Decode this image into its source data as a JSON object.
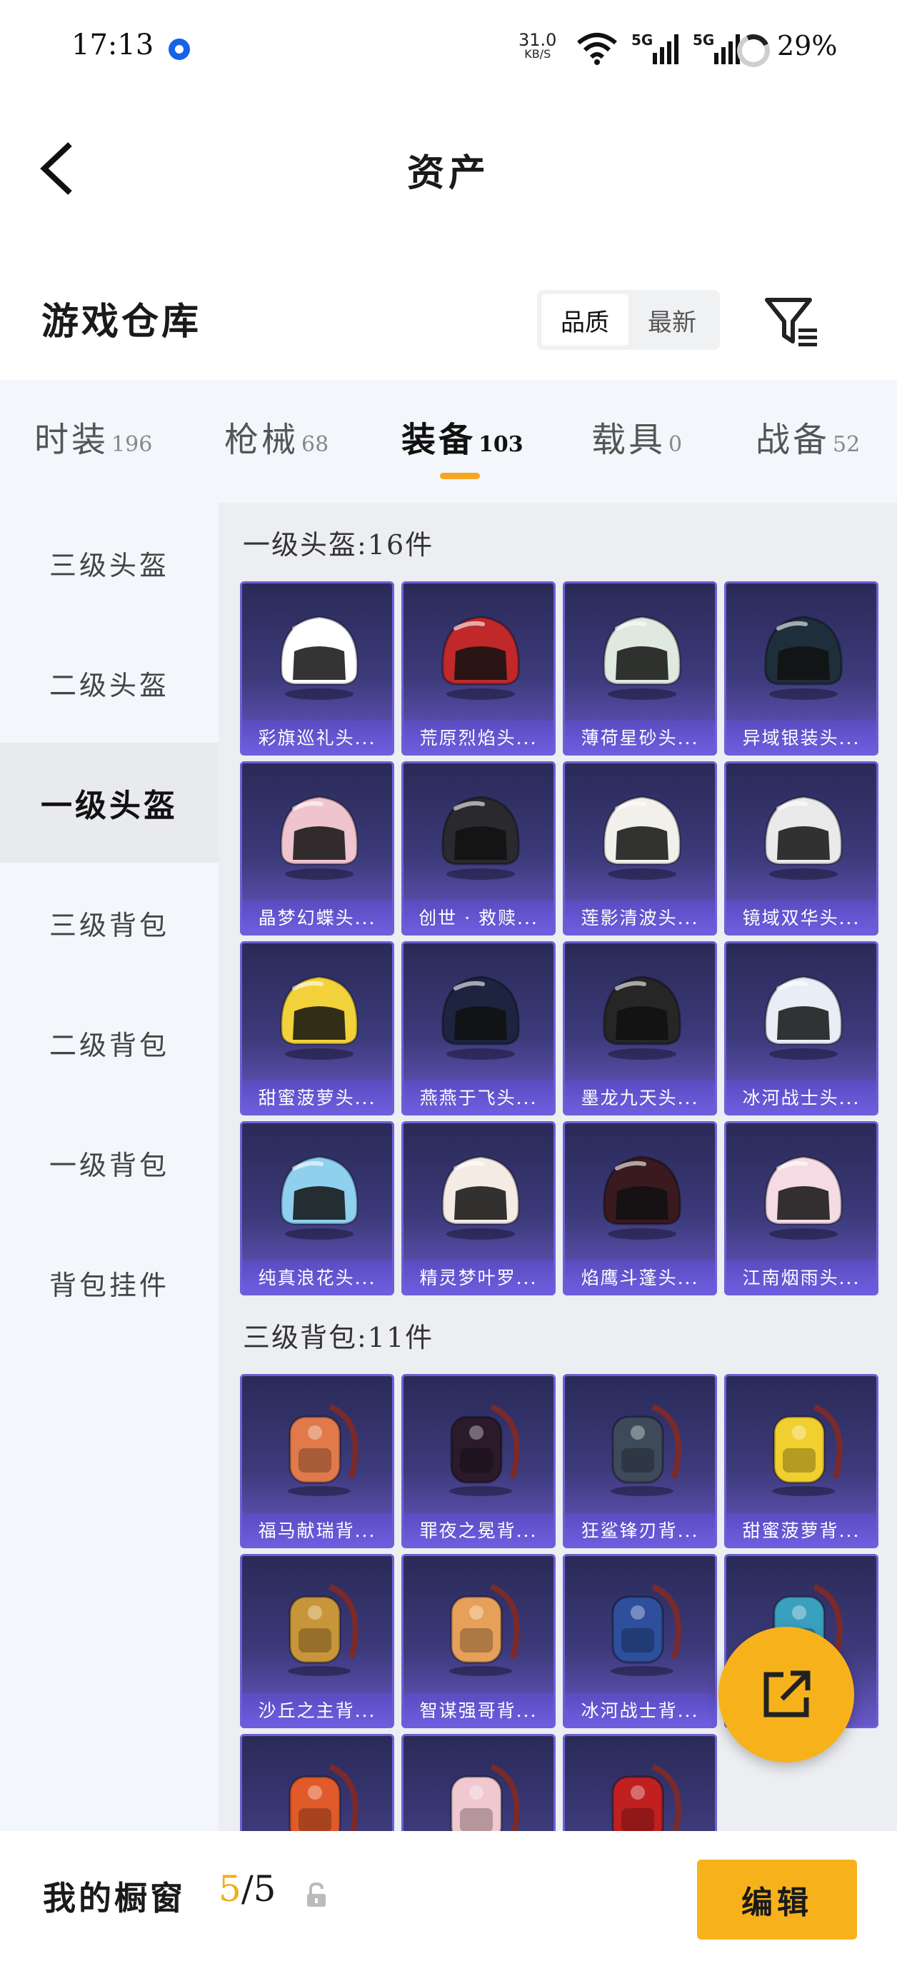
{
  "status_bar": {
    "time": "17:13",
    "net_speed_value": "31.0",
    "net_speed_unit": "KB/S",
    "signal_1": "5G",
    "signal_2": "5G",
    "battery": "29%"
  },
  "header": {
    "title": "资产",
    "back_icon": "chevron-left-icon"
  },
  "warehouse": {
    "title": "游戏仓库",
    "sort_options": [
      "品质",
      "最新"
    ],
    "sort_selected": "品质",
    "filter_icon": "filter-icon"
  },
  "tabs": [
    {
      "label": "时装",
      "count": "196",
      "active": false
    },
    {
      "label": "枪械",
      "count": "68",
      "active": false
    },
    {
      "label": "装备",
      "count": "103",
      "active": true
    },
    {
      "label": "载具",
      "count": "0",
      "active": false
    },
    {
      "label": "战备",
      "count": "52",
      "active": false
    }
  ],
  "sidebar": {
    "items": [
      {
        "label": "三级头盔",
        "active": false
      },
      {
        "label": "二级头盔",
        "active": false
      },
      {
        "label": "一级头盔",
        "active": true
      },
      {
        "label": "三级背包",
        "active": false
      },
      {
        "label": "二级背包",
        "active": false
      },
      {
        "label": "一级背包",
        "active": false
      },
      {
        "label": "背包挂件",
        "active": false
      }
    ]
  },
  "groups": [
    {
      "title": "一级头盔:16件",
      "items": [
        {
          "name": "彩旗巡礼头...",
          "icon": "helmet-icon",
          "color": "#ffffff"
        },
        {
          "name": "荒原烈焰头...",
          "icon": "helmet-icon",
          "color": "#c0282a"
        },
        {
          "name": "薄荷星砂头...",
          "icon": "helmet-icon",
          "color": "#dfe9df"
        },
        {
          "name": "异域银装头...",
          "icon": "helmet-icon",
          "color": "#1e2e3a"
        },
        {
          "name": "晶梦幻蝶头...",
          "icon": "helmet-icon",
          "color": "#f0c4cf"
        },
        {
          "name": "创世 · 救赎...",
          "icon": "helmet-icon",
          "color": "#2a2a2e"
        },
        {
          "name": "莲影清波头...",
          "icon": "helmet-icon",
          "color": "#f2f0ea"
        },
        {
          "name": "镜域双华头...",
          "icon": "helmet-icon",
          "color": "#eaeaea"
        },
        {
          "name": "甜蜜菠萝头...",
          "icon": "helmet-icon",
          "color": "#f2d23a"
        },
        {
          "name": "燕燕于飞头...",
          "icon": "helmet-icon",
          "color": "#1d2440"
        },
        {
          "name": "墨龙九天头...",
          "icon": "helmet-icon",
          "color": "#262626"
        },
        {
          "name": "冰河战士头...",
          "icon": "helmet-icon",
          "color": "#e9eef6"
        },
        {
          "name": "纯真浪花头...",
          "icon": "helmet-icon",
          "color": "#8fd0ee"
        },
        {
          "name": "精灵梦叶罗...",
          "icon": "helmet-icon",
          "color": "#f4ece4"
        },
        {
          "name": "焰鹰斗蓬头...",
          "icon": "helmet-icon",
          "color": "#3a1a1e"
        },
        {
          "name": "江南烟雨头...",
          "icon": "helmet-icon",
          "color": "#f4dbe4"
        }
      ]
    },
    {
      "title": "三级背包:11件",
      "items": [
        {
          "name": "福马献瑞背...",
          "icon": "backpack-icon",
          "color": "#e07a4a"
        },
        {
          "name": "罪夜之冕背...",
          "icon": "backpack-icon",
          "color": "#2a1a2a"
        },
        {
          "name": "狂鲨锋刃背...",
          "icon": "backpack-icon",
          "color": "#3e4a5a"
        },
        {
          "name": "甜蜜菠萝背...",
          "icon": "backpack-icon",
          "color": "#f1cf2e"
        },
        {
          "name": "沙丘之主背...",
          "icon": "backpack-icon",
          "color": "#c8963a"
        },
        {
          "name": "智谋强哥背...",
          "icon": "backpack-icon",
          "color": "#e6a05a"
        },
        {
          "name": "冰河战士背...",
          "icon": "backpack-icon",
          "color": "#2d4f9c"
        },
        {
          "name": "",
          "icon": "backpack-icon",
          "color": "#3aa0c0"
        },
        {
          "name": "",
          "icon": "backpack-icon",
          "color": "#e05a2a"
        },
        {
          "name": "",
          "icon": "backpack-icon",
          "color": "#f0c8d0"
        },
        {
          "name": "",
          "icon": "backpack-icon",
          "color": "#c02020"
        }
      ]
    }
  ],
  "fab": {
    "icon": "share-external-icon"
  },
  "bottom_bar": {
    "window_label": "我的橱窗",
    "window_current": "5",
    "window_total": "/5",
    "lock_icon": "lock-icon",
    "edit_label": "编辑"
  }
}
